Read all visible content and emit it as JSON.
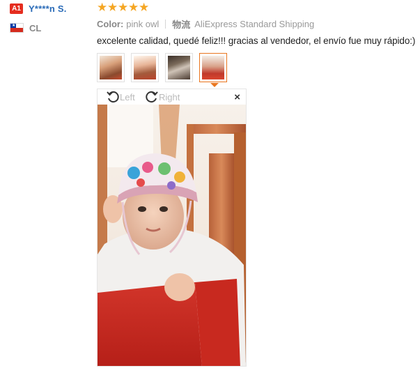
{
  "buyer": {
    "level_badge": "A1",
    "name": "Y****n S.",
    "country": "CL"
  },
  "review": {
    "rating": 5,
    "color_label": "Color:",
    "color_value": "pink owl",
    "shipping_label": "物流",
    "shipping_value": "AliExpress Standard Shipping",
    "comment": "excelente calidad, quedé feliz!!! gracias al vendedor, el envío fue muy rápido:)",
    "thumbnails": [
      "photo-1",
      "photo-2",
      "photo-3",
      "photo-4"
    ],
    "active_thumbnail": 3
  },
  "viewer": {
    "rotate_left_label": "Left",
    "rotate_right_label": "Right",
    "close_symbol": "×"
  },
  "colors": {
    "accent": "#e9761f",
    "star": "#f5a623",
    "buyer_name": "#2a6bb8",
    "badge": "#e52d1f"
  }
}
